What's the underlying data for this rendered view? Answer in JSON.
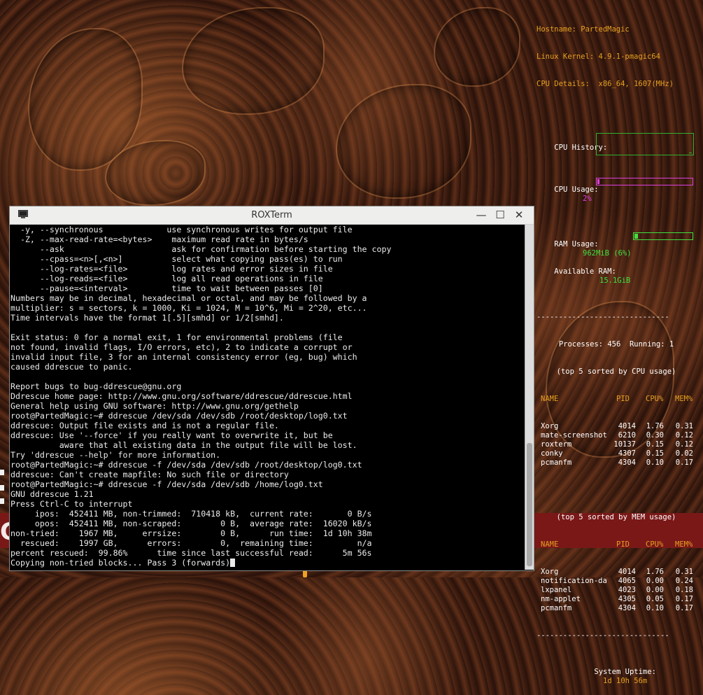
{
  "conky": {
    "hostname_label": "Hostname: PartedMagic",
    "kernel_label": "Linux Kernel: 4.9.1-pmagic64",
    "cpu_details_label": "CPU Details:  x86_64, 1607(MHz)",
    "cpu_history_label": "CPU History:",
    "cpu_usage_label": "CPU Usage:",
    "cpu_usage_value": "2%",
    "cpu_usage_fraction": 0.02,
    "ram_usage_label": "RAM Usage:",
    "ram_usage_value": "962MiB (6%)",
    "ram_usage_fraction": 0.06,
    "available_ram_label": "Available RAM:",
    "available_ram_value": "15.1GiB",
    "separator": "------------------------------",
    "processes_line": "Processes: 456  Running: 1",
    "cpu_top_title": "(top 5 sorted by CPU usage)",
    "mem_top_title": "(top 5 sorted by MEM usage)",
    "headers": [
      "NAME",
      "PID",
      "CPU%",
      "MEM%"
    ],
    "cpu_top": [
      [
        "Xorg",
        "4014",
        "1.76",
        "0.31"
      ],
      [
        "mate-screenshot",
        "6210",
        "0.30",
        "0.12"
      ],
      [
        "roxterm",
        "10137",
        "0.15",
        "0.12"
      ],
      [
        "conky",
        "4307",
        "0.15",
        "0.02"
      ],
      [
        "pcmanfm",
        "4304",
        "0.10",
        "0.17"
      ]
    ],
    "mem_top": [
      [
        "Xorg",
        "4014",
        "1.76",
        "0.31"
      ],
      [
        "notification-da",
        "4065",
        "0.00",
        "0.24"
      ],
      [
        "lxpanel",
        "4023",
        "0.00",
        "0.18"
      ],
      [
        "nm-applet",
        "4305",
        "0.05",
        "0.17"
      ],
      [
        "pcmanfm",
        "4304",
        "0.10",
        "0.17"
      ]
    ],
    "uptime_label": "System Uptime:",
    "uptime_value": "1d 10h 56m",
    "colors": {
      "orange": "#e6a020",
      "pink": "#e040e0",
      "green": "#40e040"
    }
  },
  "window": {
    "title": "ROXTerm",
    "minimize_glyph": "—",
    "maximize_glyph": "☐",
    "close_glyph": "✕"
  },
  "desktop": {
    "band_letter": "C"
  },
  "terminal": {
    "lines": [
      "  -y, --synchronous             use synchronous writes for output file",
      "  -Z, --max-read-rate=<bytes>    maximum read rate in bytes/s",
      "      --ask                      ask for confirmation before starting the copy",
      "      --cpass=<n>[,<n>]          select what copying pass(es) to run",
      "      --log-rates=<file>         log rates and error sizes in file",
      "      --log-reads=<file>         log all read operations in file",
      "      --pause=<interval>         time to wait between passes [0]",
      "Numbers may be in decimal, hexadecimal or octal, and may be followed by a",
      "multiplier: s = sectors, k = 1000, Ki = 1024, M = 10^6, Mi = 2^20, etc...",
      "Time intervals have the format 1[.5][smhd] or 1/2[smhd].",
      "",
      "Exit status: 0 for a normal exit, 1 for environmental problems (file",
      "not found, invalid flags, I/O errors, etc), 2 to indicate a corrupt or",
      "invalid input file, 3 for an internal consistency error (eg, bug) which",
      "caused ddrescue to panic.",
      "",
      "Report bugs to bug-ddrescue@gnu.org",
      "Ddrescue home page: http://www.gnu.org/software/ddrescue/ddrescue.html",
      "General help using GNU software: http://www.gnu.org/gethelp",
      "root@PartedMagic:~# ddrescue /dev/sda /dev/sdb /root/desktop/log0.txt",
      "ddrescue: Output file exists and is not a regular file.",
      "ddrescue: Use '--force' if you really want to overwrite it, but be",
      "          aware that all existing data in the output file will be lost.",
      "Try 'ddrescue --help' for more information.",
      "root@PartedMagic:~# ddrescue -f /dev/sda /dev/sdb /root/desktop/log0.txt",
      "ddrescue: Can't create mapfile: No such file or directory",
      "root@PartedMagic:~# ddrescue -f /dev/sda /dev/sdb /home/log0.txt",
      "GNU ddrescue 1.21",
      "Press Ctrl-C to interrupt",
      "     ipos:  452411 MB, non-trimmed:  710418 kB,  current rate:       0 B/s",
      "     opos:  452411 MB, non-scraped:        0 B,  average rate:  16020 kB/s",
      "non-tried:    1967 MB,     errsize:        0 B,      run time:  1d 10h 38m",
      "  rescued:    1997 GB,      errors:        0,  remaining time:         n/a",
      "percent rescued:  99.86%      time since last successful read:      5m 56s"
    ],
    "last_line": "Copying non-tried blocks... Pass 3 (forwards)"
  }
}
